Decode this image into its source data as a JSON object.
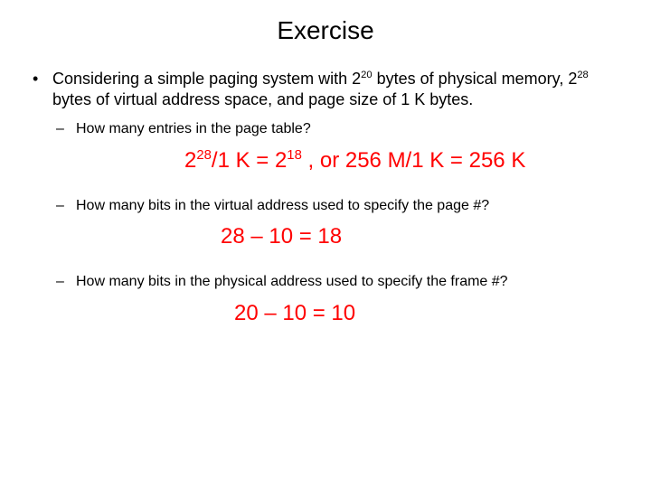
{
  "title": "Exercise",
  "bullet1": {
    "pre": "Considering a simple paging system with 2",
    "sup1": "20",
    "mid1": " bytes of physical memory, 2",
    "sup2": "28",
    "post": " bytes of virtual address space, and page size of 1 K bytes."
  },
  "q1": "How many entries in the page table?",
  "a1": {
    "p1": "2",
    "s1": "28",
    "p2": "/1 K = 2",
    "s2": "18",
    "p3": " , or 256 M/1 K = 256 K"
  },
  "q2": "How many bits in the virtual address used to specify the page #?",
  "a2": "28 – 10 = 18",
  "q3": "How many bits in the physical address used to specify the frame #?",
  "a3": "20 – 10 = 10"
}
